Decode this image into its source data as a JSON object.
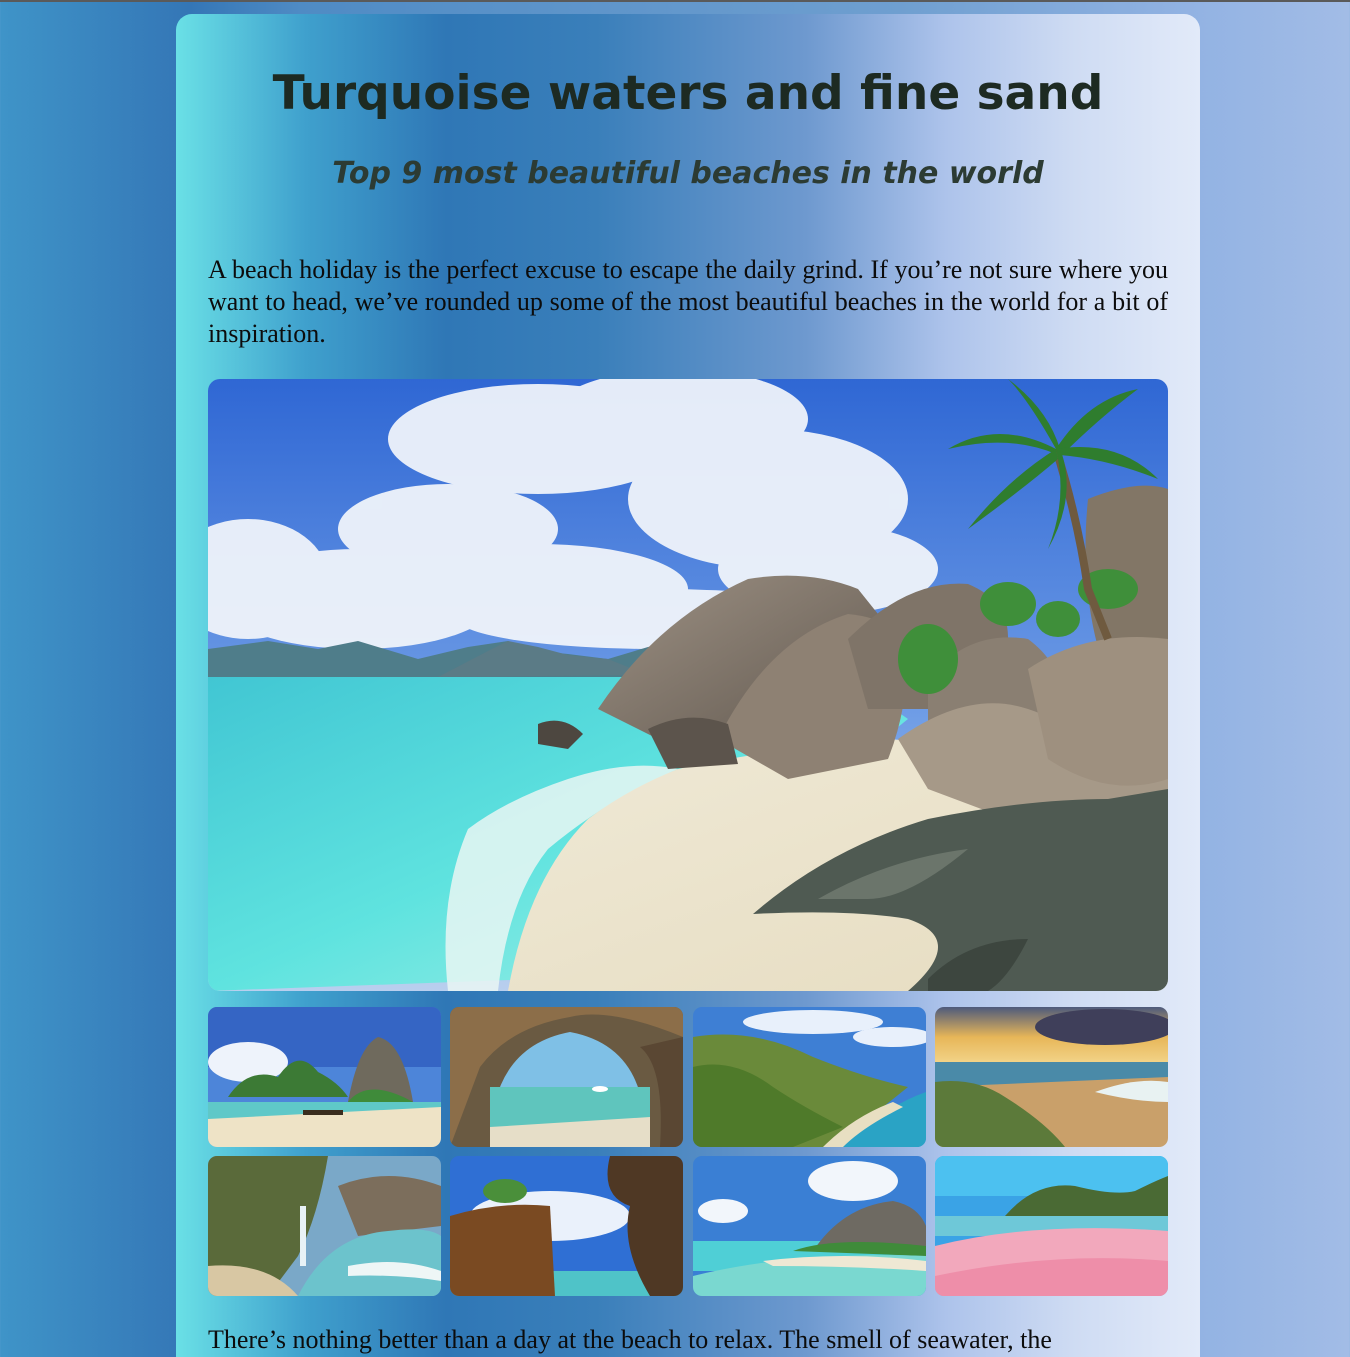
{
  "article": {
    "title": "Turquoise waters and fine sand",
    "subtitle": "Top 9 most beautiful beaches in the world",
    "intro": "A beach holiday is the perfect excuse to escape the daily grind. If you’re not sure where you want to head, we’ve rounded up some of the most beautiful beaches in the world for a bit of inspiration.",
    "outro": "There’s nothing better than a day at the beach to relax. The smell of seawater, the"
  },
  "gallery": {
    "thumbnail_count": 8
  }
}
